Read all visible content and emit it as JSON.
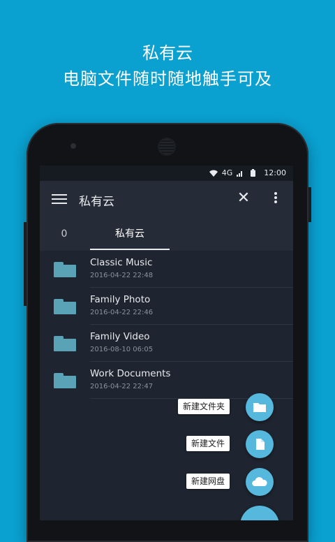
{
  "promo": {
    "title": "私有云",
    "subtitle": "电脑文件随时随地触手可及"
  },
  "statusbar": {
    "network": "4G",
    "time": "12:00"
  },
  "toolbar": {
    "title": "私有云"
  },
  "tabs": [
    {
      "label": "0"
    },
    {
      "label": "私有云",
      "selected": true
    }
  ],
  "files": [
    {
      "name": "Classic Music",
      "date": "2016-04-22 22:48"
    },
    {
      "name": "Family Photo",
      "date": "2016-04-22 22:46"
    },
    {
      "name": "Family Video",
      "date": "2016-08-10 06:05"
    },
    {
      "name": "Work Documents",
      "date": "2016-04-22 22:47"
    }
  ],
  "fab_actions": [
    {
      "label": "新建文件夹",
      "icon": "folder-icon"
    },
    {
      "label": "新建文件",
      "icon": "file-icon"
    },
    {
      "label": "新建网盘",
      "icon": "cloud-icon"
    }
  ],
  "colors": {
    "background": "#0aa0d0",
    "screen": "#1f2530",
    "accent": "#57b8de",
    "folder": "#5aa3b7"
  }
}
